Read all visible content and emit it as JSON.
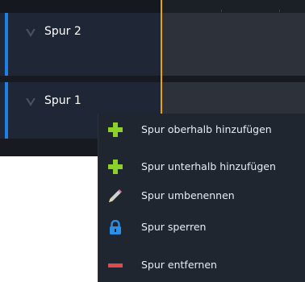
{
  "tracks": [
    {
      "label": "Spur 2",
      "accent_color": "#1f7fe5"
    },
    {
      "label": "Spur 1",
      "accent_color": "#1f7fe5"
    }
  ],
  "playhead_color": "#e8a400",
  "context_menu": {
    "items": [
      {
        "label": "Spur oberhalb hinzufügen",
        "icon": "plus-icon",
        "icon_color": "#8bd12b"
      },
      {
        "label": "Spur unterhalb hinzufügen",
        "icon": "plus-icon",
        "icon_color": "#8bd12b"
      },
      {
        "label": "Spur umbenennen",
        "icon": "pencil-icon",
        "icon_color": "#d0d0d0"
      },
      {
        "label": "Spur sperren",
        "icon": "lock-icon",
        "icon_color": "#2a8fe6"
      },
      {
        "label": "Spur entfernen",
        "icon": "minus-icon",
        "icon_color": "#e04a4a"
      }
    ]
  }
}
